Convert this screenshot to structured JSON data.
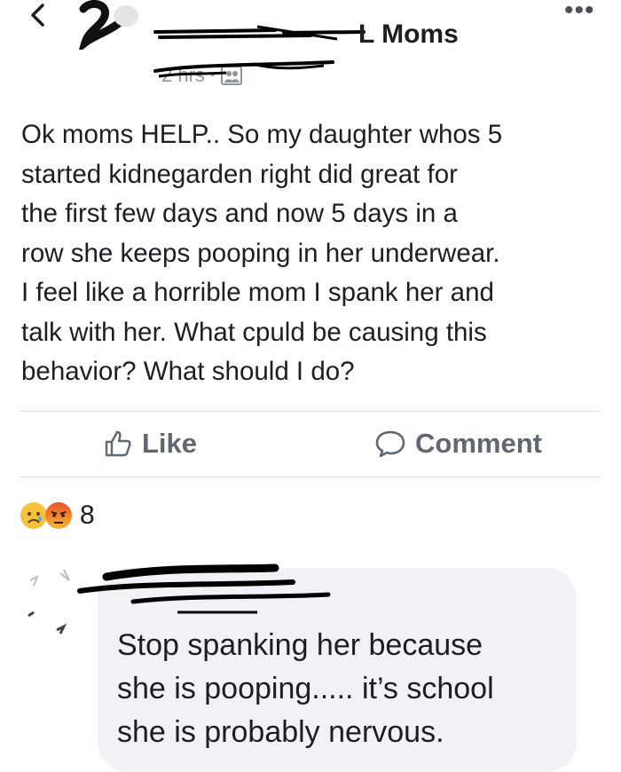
{
  "header": {
    "group_title": "L Moms",
    "time": "2 hrs",
    "separator": "•"
  },
  "post": {
    "text": "Ok moms HELP.. So my daughter whos 5\nstarted kidnegarden right did great for\nthe first few days and now 5 days in a\nrow she keeps pooping in her underwear.\nI feel like a horrible mom I spank her and\ntalk with her. What cpuld be causing this\nbehavior? What should I do?"
  },
  "actions": {
    "like_label": "Like",
    "comment_label": "Comment"
  },
  "reactions": {
    "count": "8",
    "types": [
      "sad-icon",
      "angry-icon"
    ]
  },
  "comment": {
    "text": "Stop spanking her because\nshe is pooping..... it’s school\nshe is probably nervous."
  },
  "colors": {
    "accent_gray": "#606770",
    "bubble_bg": "#f0f2f5",
    "divider": "#dadde1"
  }
}
